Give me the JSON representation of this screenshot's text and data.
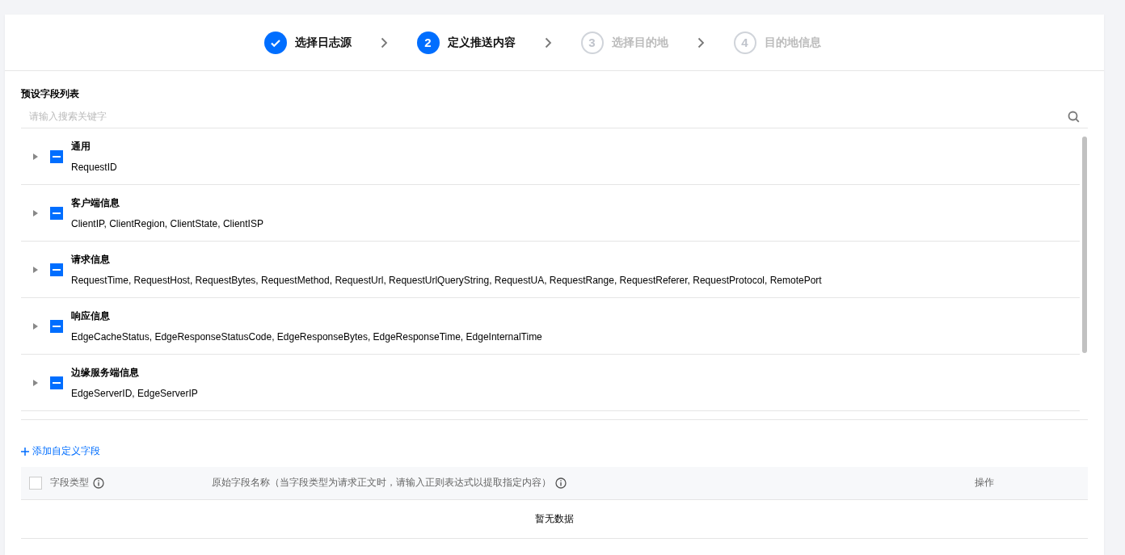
{
  "steps": [
    {
      "label": "选择日志源",
      "kind": "done"
    },
    {
      "number": "2",
      "label": "定义推送内容",
      "kind": "active"
    },
    {
      "number": "3",
      "label": "选择目的地",
      "kind": "pending"
    },
    {
      "number": "4",
      "label": "目的地信息",
      "kind": "pending"
    }
  ],
  "preset": {
    "title": "预设字段列表",
    "search": {
      "placeholder": "请输入搜索关键字"
    },
    "groups": [
      {
        "name": "通用",
        "fields": "RequestID",
        "expanded": false,
        "indeterminate": true
      },
      {
        "name": "客户端信息",
        "fields": "ClientIP, ClientRegion, ClientState, ClientISP",
        "expanded": false,
        "indeterminate": true
      },
      {
        "name": "请求信息",
        "fields": "RequestTime, RequestHost, RequestBytes, RequestMethod, RequestUrl, RequestUrlQueryString, RequestUA, RequestRange, RequestReferer, RequestProtocol, RemotePort",
        "expanded": false,
        "indeterminate": true
      },
      {
        "name": "响应信息",
        "fields": "EdgeCacheStatus, EdgeResponseStatusCode, EdgeResponseBytes, EdgeResponseTime, EdgeInternalTime",
        "expanded": false,
        "indeterminate": true
      },
      {
        "name": "边缘服务端信息",
        "fields": "EdgeServerID, EdgeServerIP",
        "expanded": false,
        "indeterminate": true
      }
    ]
  },
  "custom": {
    "add_label": "添加自定义字段",
    "table": {
      "select_all": {
        "checked": false
      },
      "columns": [
        {
          "label": "字段类型",
          "info": true
        },
        {
          "label": "原始字段名称（当字段类型为请求正文时，请输入正则表达式以提取指定内容）",
          "info": true
        },
        {
          "label": "操作",
          "info": false
        }
      ],
      "empty_text": "暂无数据"
    }
  }
}
